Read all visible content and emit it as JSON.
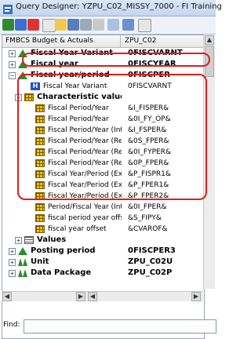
{
  "window": {
    "title": "Query Designer: YZPU_C02_MISSY_7000 - FI Training"
  },
  "tree": {
    "col1": "FMBCS Budget & Actuals",
    "col2": "ZPU_C02",
    "rows": [
      {
        "label": "Fiscal Year Variant",
        "tech": "0FISCVARNT",
        "bold": true,
        "exp": "+",
        "icon": "tri"
      },
      {
        "label": "Fiscal year",
        "tech": "0FISCYEAR",
        "bold": true,
        "exp": "+",
        "icon": "tri"
      },
      {
        "label": "Fiscal year/period",
        "tech": "0FISCPER",
        "bold": true,
        "exp": "−",
        "icon": "tri"
      },
      {
        "label": "Fiscal Year Variant",
        "tech": "0FISCVARNT",
        "bold": false,
        "exp": "",
        "icon": "h"
      },
      {
        "label": "Characteristic value",
        "tech": "",
        "bold": true,
        "exp": "−",
        "icon": "grid"
      },
      {
        "label": "Fiscal Period/Year",
        "tech": "&I_FISPER&",
        "bold": false,
        "exp": "",
        "icon": "grid"
      },
      {
        "label": "Fiscal Period/Year",
        "tech": "&0I_FY_OP&",
        "bold": false,
        "exp": "",
        "icon": "grid"
      },
      {
        "label": "Fiscal Period/Year (Inte",
        "tech": "&I_FSPER&",
        "bold": false,
        "exp": "",
        "icon": "grid"
      },
      {
        "label": "Fiscal Period/Year (Re",
        "tech": "&0S_FPER&",
        "bold": false,
        "exp": "",
        "icon": "grid"
      },
      {
        "label": "Fiscal Period/Year (Re",
        "tech": "&0I_FYPER&",
        "bold": false,
        "exp": "",
        "icon": "grid"
      },
      {
        "label": "Fiscal Period/Year (Re",
        "tech": "&0P_FPER&",
        "bold": false,
        "exp": "",
        "icon": "grid"
      },
      {
        "label": "Fiscal Year/Period (Ex",
        "tech": "&P_FISPR1&",
        "bold": false,
        "exp": "",
        "icon": "grid"
      },
      {
        "label": "Fiscal Year/Period (Ex",
        "tech": "&P_FPER1&",
        "bold": false,
        "exp": "",
        "icon": "grid"
      },
      {
        "label": "Fiscal Year/Period (Ex",
        "tech": "&P_FPER2&",
        "bold": false,
        "exp": "",
        "icon": "grid"
      },
      {
        "label": "Period/Fiscal Year (Inte",
        "tech": "&0I_FPER&",
        "bold": false,
        "exp": "",
        "icon": "grid"
      },
      {
        "label": "fiscal period year offset",
        "tech": "&S_FIPY&",
        "bold": false,
        "exp": "",
        "icon": "grid"
      },
      {
        "label": "fiscal year offset",
        "tech": "&CVAROF&",
        "bold": false,
        "exp": "",
        "icon": "grid"
      },
      {
        "label": "Values",
        "tech": "",
        "bold": true,
        "exp": "+",
        "icon": "list"
      },
      {
        "label": "Posting period",
        "tech": "0FISCPER3",
        "bold": true,
        "exp": "+",
        "icon": "tri"
      },
      {
        "label": "Unit",
        "tech": "ZPU_C02U",
        "bold": true,
        "exp": "+",
        "icon": "unit"
      },
      {
        "label": "Data Package",
        "tech": "ZPU_C02P",
        "bold": true,
        "exp": "+",
        "icon": "unit"
      }
    ]
  },
  "find": {
    "label": "Find:",
    "value": ""
  },
  "colors": {
    "annotation": "#e21b1b",
    "accent": "#1f4fc7"
  }
}
